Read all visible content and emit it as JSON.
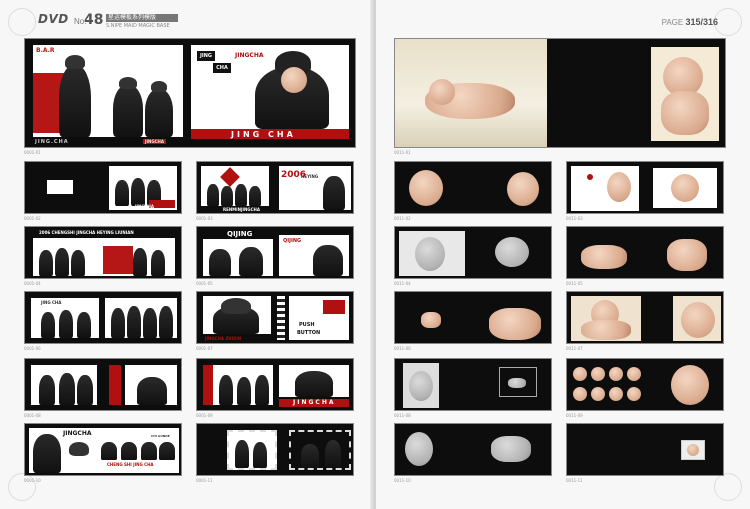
{
  "header_left": {
    "logo": "DVD",
    "no_label": "No.",
    "number": "48",
    "tag": "星运模板系列模版",
    "subtitle": "S.NIPE MAID MAGIC BASE"
  },
  "header_right": {
    "page_prefix": "PAGE",
    "page_range": "315/316"
  },
  "left_page": {
    "hero": {
      "bar_text": "B.A.R",
      "brand_top": "JING",
      "brand_mid": "CHA",
      "brand_word": "JINGCHA",
      "bottom_left": "JING.CHA",
      "bottom_banner": "JING CHA",
      "bottom_label": "JINGCHA",
      "caption": "0001-01"
    },
    "rows": [
      {
        "caption_a": "0001-02",
        "caption_b": "0001-03",
        "a_text": "JINGCHA",
        "b_big": "2006",
        "b_small": "HEYING",
        "b_bottom": "RENMINJINGCHA"
      },
      {
        "caption_a": "0001-04",
        "caption_b": "0001-05",
        "a_text": "2006 CHENGSHI JINGCHA  HEYING LIUNIAN",
        "b_title": "QIJING",
        "b_title2": "QIJING"
      },
      {
        "caption_a": "0001-06",
        "caption_b": "0001-07",
        "a_text": "JING CHA",
        "b_text1": "PUSH",
        "b_text2": "BUTTON",
        "b_text3": "JINGCHA ZHIXIN"
      },
      {
        "caption_a": "0001-08",
        "caption_b": "0001-09",
        "b_text": "JINGCHA"
      },
      {
        "caption_a": "0001-10",
        "caption_b": "0001-11",
        "a_title": "JINGCHA",
        "a_bottom": "CHENG SHI JING CHA",
        "a_note": "CHI GUNDE"
      }
    ]
  },
  "right_page": {
    "hero_caption": "0011-01",
    "rows": [
      {
        "caption_a": "0011-02",
        "caption_b": "0011-03"
      },
      {
        "caption_a": "0011-04",
        "caption_b": "0011-05"
      },
      {
        "caption_a": "0011-06",
        "caption_b": "0011-07"
      },
      {
        "caption_a": "0011-08",
        "caption_b": "0011-09"
      },
      {
        "caption_a": "0011-10",
        "caption_b": "0011-11"
      }
    ]
  }
}
